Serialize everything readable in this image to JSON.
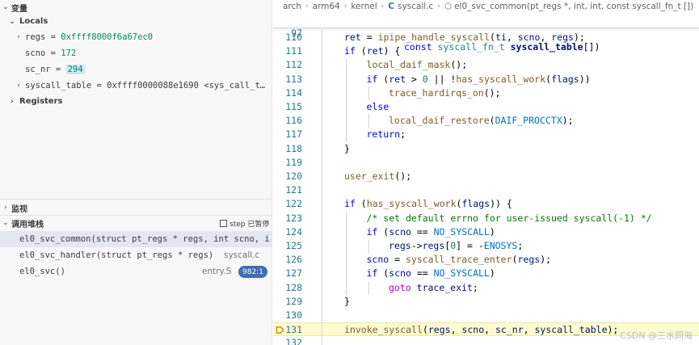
{
  "variables": {
    "header": "变量",
    "locals_label": "Locals",
    "items": [
      {
        "name": "regs",
        "eq": " = ",
        "value": "0xffff8000f6a67ec0",
        "expandable": true
      },
      {
        "name": "scno",
        "eq": " = ",
        "value": "172",
        "expandable": false
      },
      {
        "name": "sc_nr",
        "eq": " = ",
        "value": "294",
        "expandable": false,
        "highlighted": true
      },
      {
        "name": "syscall_table",
        "eq": " = ",
        "value": "0xffff0000088e1690 <sys_call_t…",
        "expandable": true
      }
    ],
    "registers_label": "Registers"
  },
  "watch": {
    "header": "监视"
  },
  "callstack": {
    "header": "调用堆栈",
    "paused_label": "step 已暂停",
    "frames": [
      {
        "fn": "el0_svc_common(struct pt_regs * regs, int scno, i",
        "file": "",
        "selected": true
      },
      {
        "fn": "el0_svc_handler(struct pt_regs * regs)",
        "file": "syscall.c",
        "selected": false
      },
      {
        "fn": "el0_svc()",
        "file": "entry.S",
        "badge": "982:1",
        "selected": false
      }
    ]
  },
  "breadcrumb": {
    "parts": [
      "arch",
      "arm64",
      "kernel"
    ],
    "file": "syscall.c",
    "symbol": "el0_svc_common(pt_regs *, int, int, const syscall_fn_t [])"
  },
  "sticky": {
    "ln": "97",
    "text": "const syscall_fn_t syscall_table[])"
  },
  "lines": [
    {
      "ln": "110",
      "text": "ret = ipipe_handle_syscall(ti, scno, regs);"
    },
    {
      "ln": "111",
      "text": "if (ret) {"
    },
    {
      "ln": "112",
      "text": "local_daif_mask();"
    },
    {
      "ln": "113",
      "text": "if (ret > 0 || !has_syscall_work(flags))"
    },
    {
      "ln": "114",
      "text": "trace_hardirqs_on();"
    },
    {
      "ln": "115",
      "text": "else"
    },
    {
      "ln": "116",
      "text": "local_daif_restore(DAIF_PROCCTX);"
    },
    {
      "ln": "117",
      "text": "return;"
    },
    {
      "ln": "118",
      "text": "}"
    },
    {
      "ln": "119",
      "text": ""
    },
    {
      "ln": "120",
      "text": "user_exit();"
    },
    {
      "ln": "121",
      "text": ""
    },
    {
      "ln": "122",
      "text": "if (has_syscall_work(flags)) {"
    },
    {
      "ln": "123",
      "text": "/* set default errno for user-issued syscall(-1) */"
    },
    {
      "ln": "124",
      "text": "if (scno == NO_SYSCALL)"
    },
    {
      "ln": "125",
      "text": "regs->regs[0] = -ENOSYS;"
    },
    {
      "ln": "126",
      "text": "scno = syscall_trace_enter(regs);"
    },
    {
      "ln": "127",
      "text": "if (scno == NO_SYSCALL)"
    },
    {
      "ln": "128",
      "text": "goto trace_exit;"
    },
    {
      "ln": "129",
      "text": "}"
    },
    {
      "ln": "130",
      "text": ""
    },
    {
      "ln": "131",
      "text": "invoke_syscall(regs, scno, sc_nr, syscall_table);"
    },
    {
      "ln": "132",
      "text": ""
    }
  ],
  "current_line": "131",
  "watermark": "CSDN @三水同海"
}
